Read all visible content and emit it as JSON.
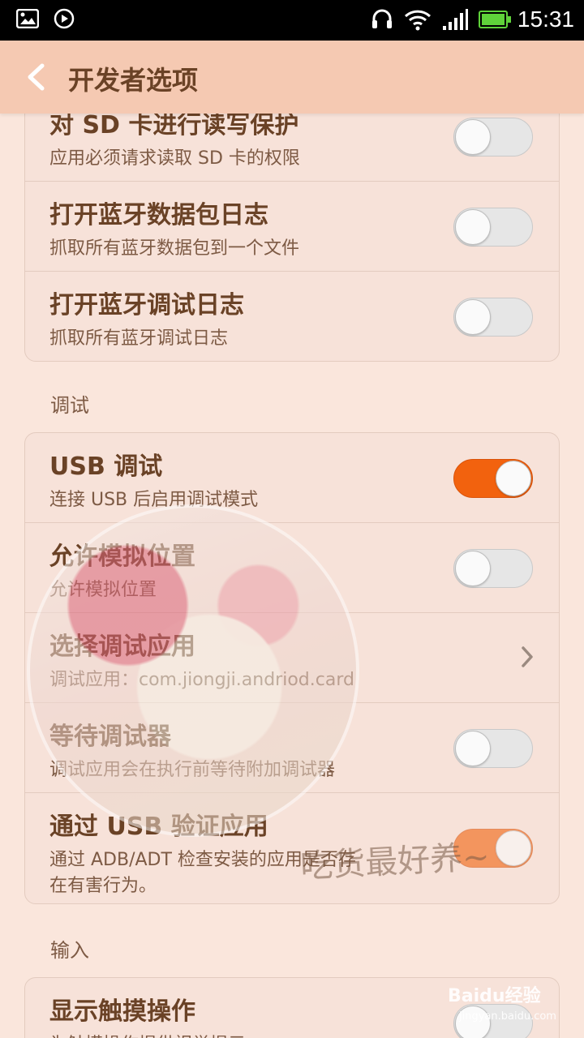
{
  "status_bar": {
    "time": "15:31",
    "icons": [
      "image-notification-icon",
      "play-notification-icon",
      "headset-icon",
      "wifi-icon",
      "signal-icon",
      "battery-icon"
    ]
  },
  "header": {
    "title": "开发者选项",
    "back_icon": "chevron-left-icon"
  },
  "groups": [
    {
      "rows": [
        {
          "title": "对 SD 卡进行读写保护",
          "subtitle": "应用必须请求读取 SD 卡的权限",
          "toggle": false
        },
        {
          "title": "打开蓝牙数据包日志",
          "subtitle": "抓取所有蓝牙数据包到一个文件",
          "toggle": false
        },
        {
          "title": "打开蓝牙调试日志",
          "subtitle": "抓取所有蓝牙调试日志",
          "toggle": false
        }
      ]
    },
    {
      "section_label": "调试",
      "rows": [
        {
          "title": "USB 调试",
          "subtitle": "连接 USB 后启用调试模式",
          "toggle": true
        },
        {
          "title": "允许模拟位置",
          "subtitle": "允许模拟位置",
          "toggle": false
        },
        {
          "title": "选择调试应用",
          "subtitle": "调试应用：com.jiongji.andriod.card",
          "chevron": "chevron-right-icon"
        },
        {
          "title": "等待调试器",
          "subtitle": "调试应用会在执行前等待附加调试器",
          "toggle": false
        },
        {
          "title": "通过 USB 验证应用",
          "subtitle_line1": "通过 ADB/ADT 检查安装的应用是否存",
          "subtitle_line2": "在有害行为。",
          "toggle": true
        }
      ]
    },
    {
      "section_label": "输入",
      "rows": [
        {
          "title": "显示触摸操作",
          "subtitle": "为触摸操作提供视觉提示",
          "toggle": false
        }
      ]
    }
  ],
  "overlays": {
    "watermark_text": "吃货最好养~",
    "baidu_logo": "Baidu经验",
    "baidu_url": "jingyan.baidu.com"
  },
  "colors": {
    "accent": "#f2620e",
    "header_bg": "#f5c9b2",
    "page_bg": "#fae6dc",
    "title_text": "#6a4226"
  }
}
